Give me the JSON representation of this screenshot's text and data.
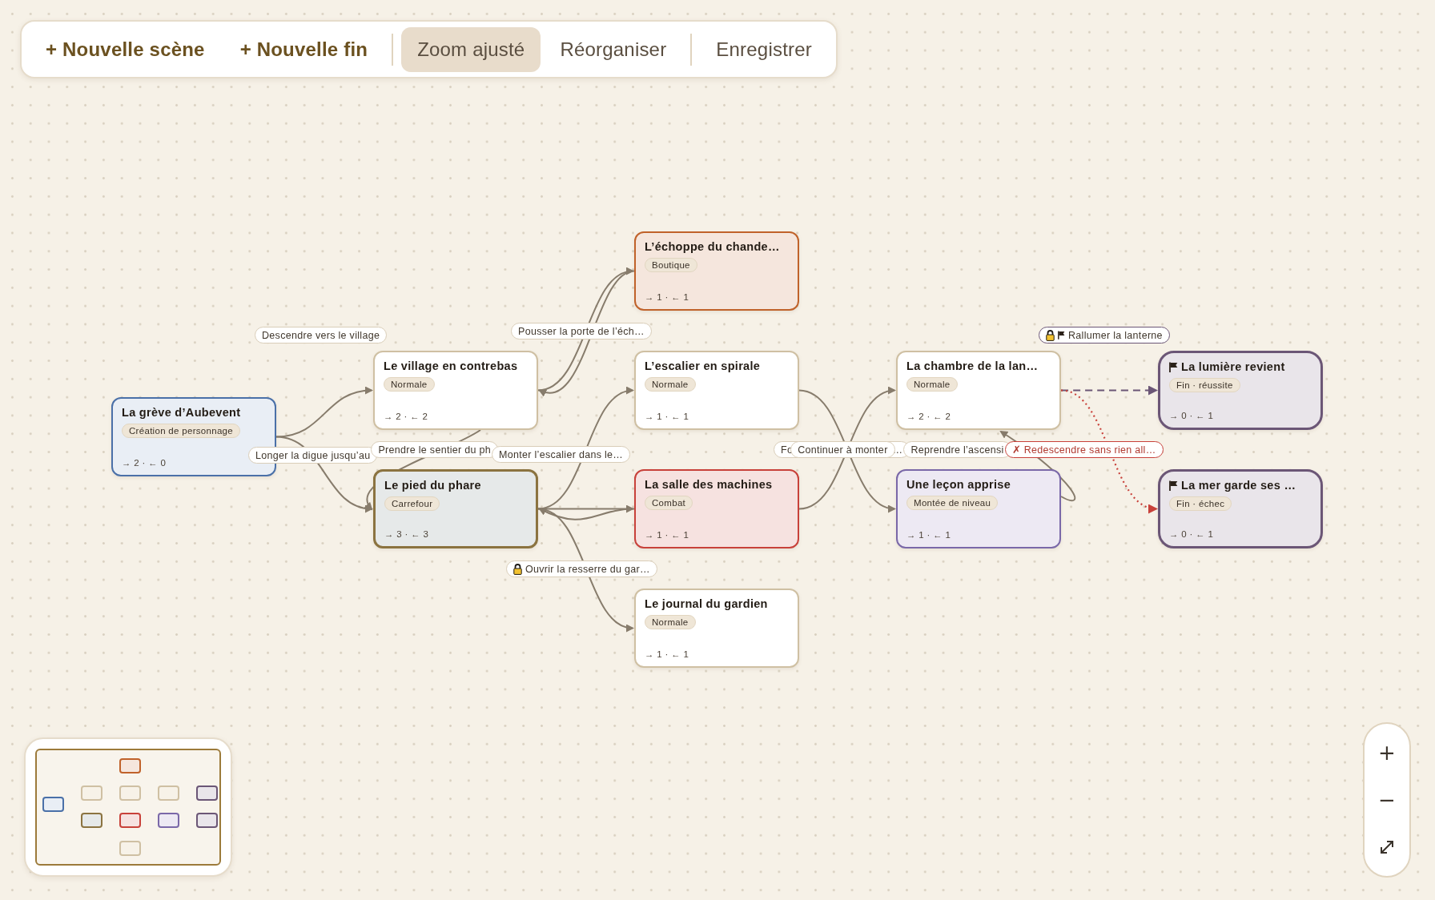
{
  "toolbar": {
    "groups": [
      {
        "buttons": [
          {
            "label": "+ Nouvelle scène",
            "kind": "primary",
            "selected": false
          },
          {
            "label": "+ Nouvelle fin",
            "kind": "primary",
            "selected": false
          }
        ]
      },
      {
        "buttons": [
          {
            "label": "Zoom ajusté",
            "kind": "plain",
            "selected": true
          },
          {
            "label": "Réorganiser",
            "kind": "plain",
            "selected": false
          }
        ]
      },
      {
        "buttons": [
          {
            "label": "Enregistrer",
            "kind": "plain",
            "selected": false
          }
        ]
      }
    ]
  },
  "scenes": [
    {
      "title": "La grève d’Aubevent",
      "tag": "Création de personnage",
      "stats": "→ 2 · ← 0",
      "kind": "start"
    },
    {
      "title": "Le village en contrebas",
      "tag": "Normale",
      "stats": "→ 2 · ← 2",
      "kind": "normal"
    },
    {
      "title": "Le pied du phare",
      "tag": "Carrefour",
      "stats": "→ 3 · ← 3",
      "kind": "hub"
    },
    {
      "title": "L’échoppe du chande…",
      "tag": "Boutique",
      "stats": "→ 1 · ← 1",
      "kind": "shop"
    },
    {
      "title": "L’escalier en spirale",
      "tag": "Normale",
      "stats": "→ 1 · ← 1",
      "kind": "normal"
    },
    {
      "title": "La salle des machines",
      "tag": "Combat",
      "stats": "→ 1 · ← 1",
      "kind": "combat"
    },
    {
      "title": "Le journal du gardien",
      "tag": "Normale",
      "stats": "→ 1 · ← 1",
      "kind": "normal"
    },
    {
      "title": "La chambre de la lan…",
      "tag": "Normale",
      "stats": "→ 2 · ← 2",
      "kind": "normal"
    },
    {
      "title": "Une leçon apprise",
      "tag": "Montée de niveau",
      "stats": "→ 1 · ← 1",
      "kind": "levelup"
    },
    {
      "title": "La lumière revient",
      "tag": "Fin · réussite",
      "stats": "→ 0 · ← 1",
      "kind": "ending"
    },
    {
      "title": "La mer garde ses …",
      "tag": "Fin · échec",
      "stats": "→ 0 · ← 1",
      "kind": "ending"
    }
  ],
  "edge_labels": [
    {
      "text": "Descendre vers le village",
      "kind": "normal"
    },
    {
      "text": "Pousser la porte de l’éch…",
      "kind": "normal"
    },
    {
      "text": "Longer la digue jusqu’au",
      "kind": "normal"
    },
    {
      "text": "Prendre le sentier du ph",
      "kind": "normal"
    },
    {
      "text": "Monter l’escalier dans le…",
      "kind": "normal"
    },
    {
      "text": "Fo",
      "tail": "…",
      "kind": "normal"
    },
    {
      "text": "Continuer à monter",
      "kind": "normal"
    },
    {
      "text": "Reprendre l’ascensi",
      "kind": "normal"
    },
    {
      "text": "✗ Redescendre sans rien all…",
      "kind": "failure"
    },
    {
      "text": "Ouvrir la resserre du gar…",
      "kind": "locked"
    },
    {
      "text": "Rallumer la lanterne",
      "kind": "locked-success"
    }
  ],
  "zoom_controls": {
    "buttons": [
      "+",
      "−"
    ]
  }
}
